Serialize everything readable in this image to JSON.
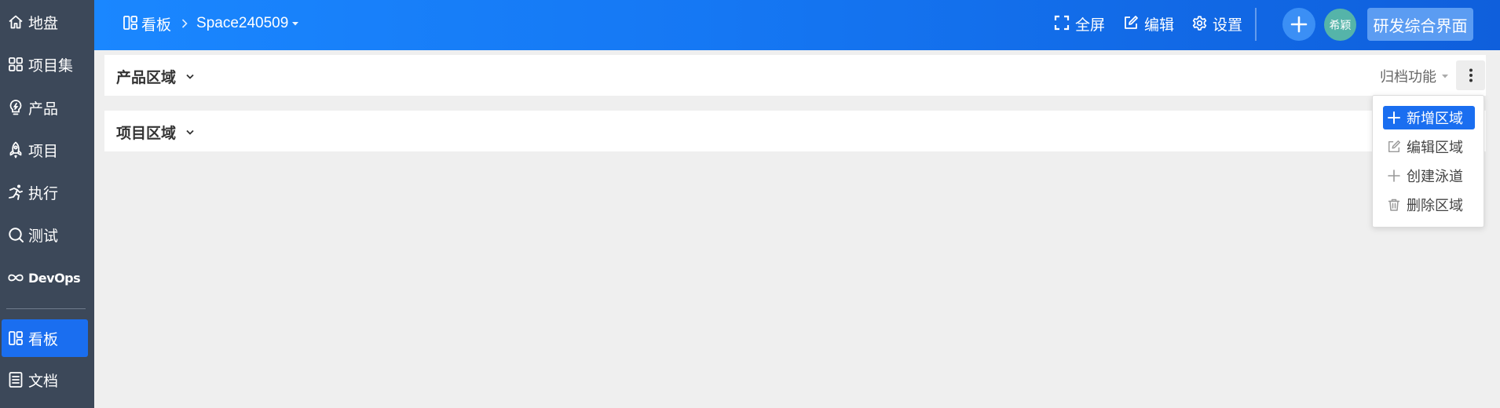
{
  "sidebar": {
    "items": [
      {
        "label": "地盘",
        "icon": "home-icon"
      },
      {
        "label": "项目集",
        "icon": "grid-icon"
      },
      {
        "label": "产品",
        "icon": "lightbulb-icon"
      },
      {
        "label": "项目",
        "icon": "rocket-icon"
      },
      {
        "label": "执行",
        "icon": "running-icon"
      },
      {
        "label": "测试",
        "icon": "magnifier-icon"
      },
      {
        "label": "DevOps",
        "icon": "infinity-icon"
      },
      {
        "label": "看板",
        "icon": "kanban-icon",
        "active": true
      },
      {
        "label": "文档",
        "icon": "document-icon"
      }
    ]
  },
  "header": {
    "breadcrumb_root": "看板",
    "space_name": "Space240509",
    "fullscreen_label": "全屏",
    "edit_label": "编辑",
    "settings_label": "设置",
    "avatar_text": "希颖",
    "app_switch_label": "研发综合界面"
  },
  "regions": [
    {
      "title": "产品区域",
      "archive_label": "归档功能"
    },
    {
      "title": "项目区域"
    }
  ],
  "dropdown": {
    "items": [
      {
        "label": "新增区域",
        "icon": "plus-icon",
        "active": true
      },
      {
        "label": "编辑区域",
        "icon": "edit-icon"
      },
      {
        "label": "创建泳道",
        "icon": "plus-icon"
      },
      {
        "label": "删除区域",
        "icon": "trash-icon"
      }
    ]
  },
  "colors": {
    "sidebar_bg": "#3c4859",
    "accent": "#1a6ef0",
    "header_gradient_start": "#1a87ff",
    "header_gradient_end": "#0f5fdc",
    "avatar_bg": "#55b4a9"
  }
}
